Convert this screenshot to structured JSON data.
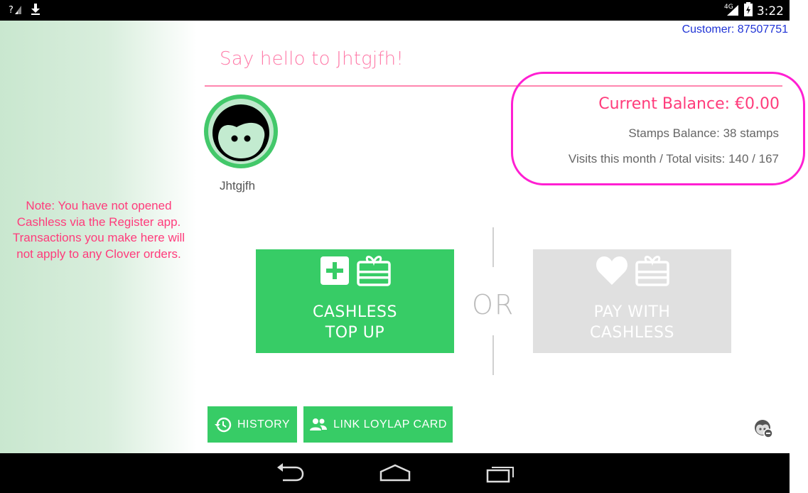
{
  "status_bar": {
    "time": "3:22",
    "network": "4G"
  },
  "sidebar": {
    "note": "Note: You have not opened Cashless via the Register app. Transactions you make here will not apply to any Clover orders."
  },
  "header": {
    "customer": "Customer: 87507751",
    "greeting": "Say hello to Jhtgjfh!"
  },
  "profile": {
    "name": "Jhtgjfh"
  },
  "balance": {
    "current": "Current Balance: €0.00",
    "stamps": "Stamps Balance: 38 stamps",
    "visits": "Visits this month / Total visits: 140 / 167"
  },
  "actions": {
    "or_label": "OR",
    "topup_line1": "CASHLESS",
    "topup_line2": "TOP UP",
    "pay_line1": "PAY WITH",
    "pay_line2": "CASHLESS"
  },
  "bottom_buttons": {
    "history": "HISTORY",
    "link_card": "LINK LOYLAP CARD"
  },
  "colors": {
    "accent_green": "#37cc66",
    "accent_pink": "#ff3b7b",
    "highlight_magenta": "#ff1fd2",
    "disabled_gray": "#e0e0e0",
    "customer_blue": "#2034d6"
  },
  "icons": {
    "signal": "signal-unknown-icon",
    "download": "download-icon",
    "battery": "battery-icon",
    "plus": "plus-box-icon",
    "gift": "gift-card-icon",
    "heart": "heart-icon",
    "history": "history-icon",
    "people": "people-icon",
    "face_settings": "face-settings-icon",
    "back": "back-icon",
    "home": "home-icon",
    "recents": "recents-icon"
  }
}
